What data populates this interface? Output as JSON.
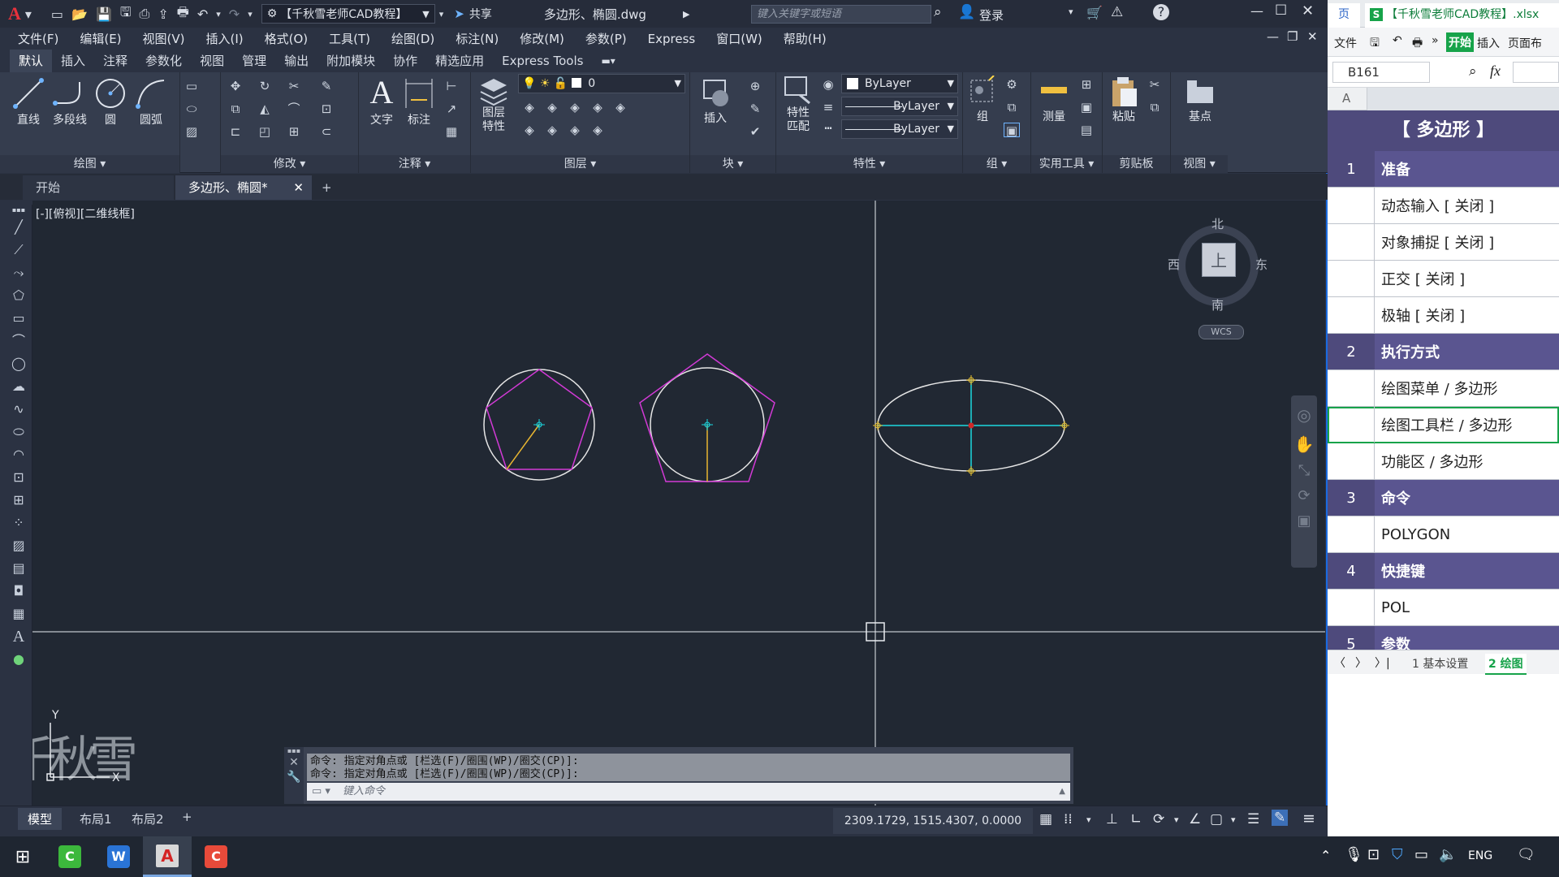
{
  "titlebar": {
    "logo": "A",
    "workspace": "【千秋雪老师CAD教程】",
    "share": "共享",
    "filename": "多边形、椭圆.dwg",
    "search_placeholder": "键入关键字或短语",
    "login": "登录"
  },
  "menu": [
    "文件(F)",
    "编辑(E)",
    "视图(V)",
    "插入(I)",
    "格式(O)",
    "工具(T)",
    "绘图(D)",
    "标注(N)",
    "修改(M)",
    "参数(P)",
    "Express",
    "窗口(W)",
    "帮助(H)"
  ],
  "ribbon_tabs": [
    "默认",
    "插入",
    "注释",
    "参数化",
    "视图",
    "管理",
    "输出",
    "附加模块",
    "协作",
    "精选应用",
    "Express Tools"
  ],
  "ribbon": {
    "draw": {
      "title": "绘图",
      "line": "直线",
      "pline": "多段线",
      "circle": "圆",
      "arc": "圆弧"
    },
    "modify": {
      "title": "修改"
    },
    "annot": {
      "title": "注释",
      "text": "文字",
      "dim": "标注"
    },
    "layers": {
      "title": "图层",
      "props": "图层\n特性",
      "current": "0"
    },
    "block": {
      "title": "块",
      "insert": "插入"
    },
    "props": {
      "title": "特性",
      "match": "特性\n匹配",
      "color": "ByLayer",
      "linetype": "ByLayer",
      "lineweight": "ByLayer"
    },
    "group": {
      "title": "组",
      "label": "组"
    },
    "util": {
      "title": "实用工具",
      "measure": "测量"
    },
    "clip": {
      "title": "剪贴板",
      "paste": "粘贴"
    },
    "view": {
      "title": "视图",
      "base": "基点"
    }
  },
  "doctabs": {
    "start": "开始",
    "active": "多边形、椭圆*"
  },
  "viewport": {
    "label": "[-][俯视][二维线框]",
    "compass": {
      "n": "北",
      "s": "南",
      "e": "东",
      "w": "西",
      "top": "上",
      "wcs": "WCS"
    }
  },
  "command": {
    "line1": "命令: 指定对角点或 [栏选(F)/圈围(WP)/圈交(CP)]:",
    "line2": "命令: 指定对角点或 [栏选(F)/圈围(WP)/圈交(CP)]:",
    "placeholder": "键入命令"
  },
  "layout_tabs": [
    "模型",
    "布局1",
    "布局2"
  ],
  "coords": "2309.1729, 1515.4307, 0.0000",
  "watermark": "千秋雪",
  "excel": {
    "tab_left": "页",
    "tab_title": "【千秋雪老师CAD教程】.xlsx",
    "menu_file": "文件",
    "menu_start": "开始",
    "menu_insert": "插入",
    "menu_layout": "页面布",
    "cellref": "B161",
    "fx": "fx",
    "col": "A",
    "sheet_title": "【 多边形 】",
    "rows": [
      {
        "num": "1",
        "text": "准备",
        "header": true
      },
      {
        "num": "",
        "text": "动态输入 [ 关闭 ]",
        "header": false
      },
      {
        "num": "",
        "text": "对象捕捉 [ 关闭 ]",
        "header": false
      },
      {
        "num": "",
        "text": "正交 [ 关闭 ]",
        "header": false
      },
      {
        "num": "",
        "text": "极轴 [ 关闭 ]",
        "header": false
      },
      {
        "num": "2",
        "text": "执行方式",
        "header": true
      },
      {
        "num": "",
        "text": "绘图菜单 / 多边形",
        "header": false
      },
      {
        "num": "",
        "text": "绘图工具栏 / 多边形",
        "header": false
      },
      {
        "num": "",
        "text": "功能区 / 多边形",
        "header": false
      },
      {
        "num": "3",
        "text": "命令",
        "header": true
      },
      {
        "num": "",
        "text": "POLYGON",
        "header": false
      },
      {
        "num": "4",
        "text": "快捷键",
        "header": true
      },
      {
        "num": "",
        "text": "POL",
        "header": false
      },
      {
        "num": "5",
        "text": "参数",
        "header": true
      }
    ],
    "sheets": [
      "1 基本设置",
      "2 绘图"
    ]
  },
  "taskbar": {
    "lang": "ENG"
  }
}
